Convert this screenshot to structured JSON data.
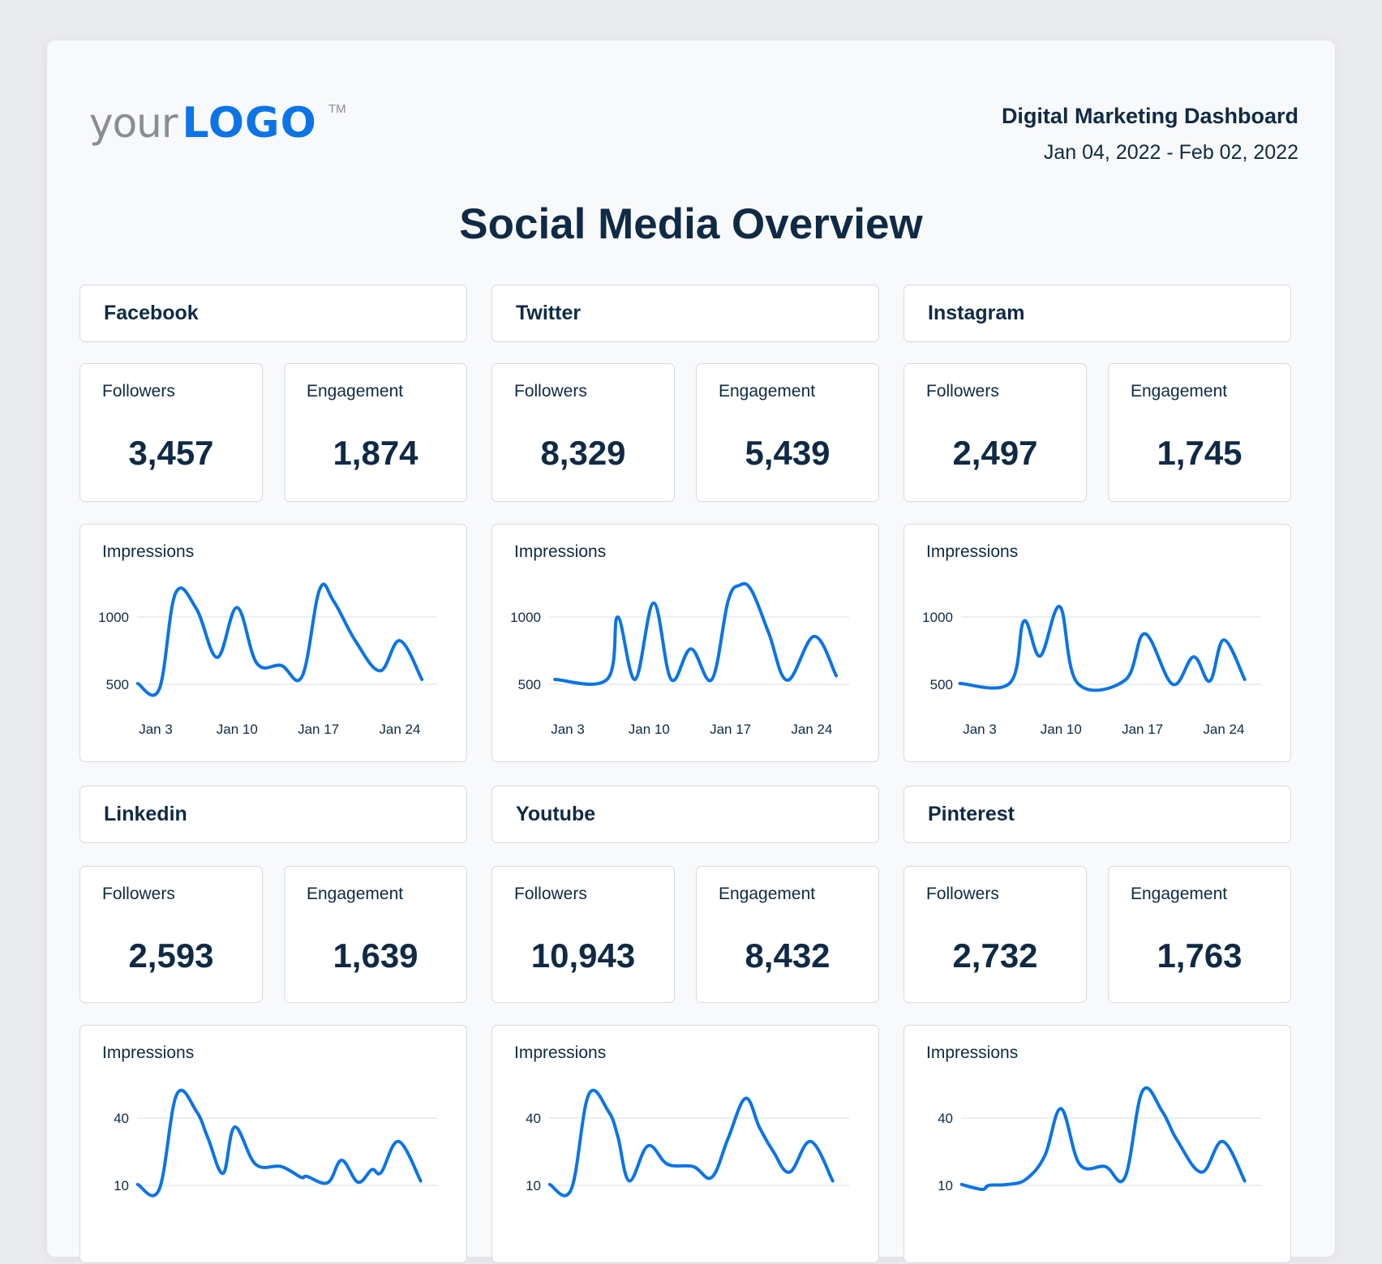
{
  "logo": {
    "your": "your",
    "brand": "LOGO",
    "tm": "TM"
  },
  "header": {
    "title": "Digital Marketing Dashboard",
    "date_range": "Jan 04, 2022 - Feb 02, 2022"
  },
  "page_title": "Social Media Overview",
  "colors": {
    "accent": "#0b74e6",
    "text": "#0f2a45",
    "logo_gray": "#8b8d90",
    "grid": "#e6e8ec"
  },
  "platforms": [
    {
      "name": "Facebook",
      "followers_label": "Followers",
      "followers": "3,457",
      "engagement_label": "Engagement",
      "engagement": "1,874",
      "chart_label": "Impressions"
    },
    {
      "name": "Twitter",
      "followers_label": "Followers",
      "followers": "8,329",
      "engagement_label": "Engagement",
      "engagement": "5,439",
      "chart_label": "Impressions"
    },
    {
      "name": "Instagram",
      "followers_label": "Followers",
      "followers": "2,497",
      "engagement_label": "Engagement",
      "engagement": "1,745",
      "chart_label": "Impressions"
    },
    {
      "name": "Linkedin",
      "followers_label": "Followers",
      "followers": "2,593",
      "engagement_label": "Engagement",
      "engagement": "1,639",
      "chart_label": "Impressions"
    },
    {
      "name": "Youtube",
      "followers_label": "Followers",
      "followers": "10,943",
      "engagement_label": "Engagement",
      "engagement": "8,432",
      "chart_label": "Impressions"
    },
    {
      "name": "Pinterest",
      "followers_label": "Followers",
      "followers": "2,732",
      "engagement_label": "Engagement",
      "engagement": "1,763",
      "chart_label": "Impressions"
    }
  ],
  "chart_data": [
    {
      "type": "line",
      "title": "Impressions",
      "platform": "Facebook",
      "xlabel": "",
      "ylabel": "",
      "grid": true,
      "x_unit": "day of January",
      "x_ticks": [
        3,
        10,
        17,
        24
      ],
      "x_tick_labels": [
        "Jan 3",
        "Jan 10",
        "Jan 17",
        "Jan 24"
      ],
      "y_ticks": [
        500,
        1000
      ],
      "y_tick_labels": [
        "500",
        "1000"
      ],
      "ylim": [
        300,
        1300
      ],
      "xlim": [
        1,
        27
      ],
      "series": [
        {
          "name": "Impressions",
          "x": [
            1.45,
            3.3,
            4.7,
            6.5,
            8.3,
            10.0,
            11.7,
            13.8,
            15.6,
            17.1,
            18.3,
            20.2,
            22.3,
            24.0,
            25.9
          ],
          "y": [
            506,
            464,
            1176,
            1060,
            700,
            1070,
            656,
            640,
            560,
            1204,
            1120,
            820,
            600,
            824,
            536
          ]
        }
      ]
    },
    {
      "type": "line",
      "title": "Impressions",
      "platform": "Twitter",
      "xlabel": "",
      "ylabel": "",
      "grid": true,
      "x_unit": "day of January",
      "x_ticks": [
        3,
        10,
        17,
        24
      ],
      "x_tick_labels": [
        "Jan 3",
        "Jan 10",
        "Jan 17",
        "Jan 24"
      ],
      "y_ticks": [
        500,
        1000
      ],
      "y_tick_labels": [
        "500",
        "1000"
      ],
      "ylim": [
        300,
        1300
      ],
      "xlim": [
        1,
        27
      ],
      "series": [
        {
          "name": "Impressions",
          "x": [
            1.9,
            6.4,
            7.3,
            8.8,
            10.4,
            11.9,
            13.6,
            15.4,
            16.8,
            17.8,
            18.8,
            20.3,
            21.9,
            24.2,
            26.1
          ],
          "y": [
            536,
            538,
            1000,
            536,
            1104,
            536,
            764,
            536,
            1120,
            1236,
            1200,
            880,
            530,
            856,
            564
          ]
        }
      ]
    },
    {
      "type": "line",
      "title": "Impressions",
      "platform": "Instagram",
      "xlabel": "",
      "ylabel": "",
      "grid": true,
      "x_unit": "day of January",
      "x_ticks": [
        3,
        10,
        17,
        24
      ],
      "x_tick_labels": [
        "Jan 3",
        "Jan 10",
        "Jan 17",
        "Jan 24"
      ],
      "y_ticks": [
        500,
        1000
      ],
      "y_tick_labels": [
        "500",
        "1000"
      ],
      "ylim": [
        300,
        1300
      ],
      "xlim": [
        1,
        27
      ],
      "series": [
        {
          "name": "Impressions",
          "x": [
            1.3,
            5.6,
            6.8,
            8.2,
            9.9,
            11.4,
            15.5,
            17.2,
            19.6,
            21.4,
            22.8,
            24.0,
            25.8
          ],
          "y": [
            506,
            510,
            970,
            710,
            1076,
            510,
            530,
            876,
            500,
            704,
            524,
            830,
            536
          ]
        }
      ]
    },
    {
      "type": "line",
      "title": "Impressions",
      "platform": "Linkedin",
      "xlabel": "",
      "ylabel": "",
      "grid": true,
      "x_unit": "day of January",
      "y_ticks": [
        10,
        40
      ],
      "y_tick_labels": [
        "10",
        "40"
      ],
      "ylim": [
        -10,
        60
      ],
      "xlim": [
        1,
        27
      ],
      "series": [
        {
          "name": "Impressions",
          "x": [
            1.45,
            3.3,
            4.8,
            6.5,
            7.5,
            8.8,
            9.8,
            11.6,
            13.8,
            15.5,
            16.0,
            17.8,
            19.0,
            20.4,
            21.6,
            22.4,
            23.9,
            25.8
          ],
          "y": [
            10.4,
            8.2,
            50.4,
            43,
            31,
            15.4,
            36,
            19.4,
            18.4,
            13.6,
            14,
            11.2,
            21.2,
            11.4,
            17,
            15.8,
            29.6,
            12
          ]
        }
      ]
    },
    {
      "type": "line",
      "title": "Impressions",
      "platform": "Youtube",
      "xlabel": "",
      "ylabel": "",
      "grid": true,
      "x_unit": "day of January",
      "y_ticks": [
        10,
        40
      ],
      "y_tick_labels": [
        "10",
        "40"
      ],
      "ylim": [
        -10,
        60
      ],
      "xlim": [
        1,
        27
      ],
      "series": [
        {
          "name": "Impressions",
          "x": [
            1.45,
            3.3,
            4.8,
            6.5,
            7.3,
            8.3,
            9.9,
            11.6,
            13.8,
            15.4,
            16.8,
            18.3,
            19.5,
            20.7,
            22.1,
            23.9,
            25.8
          ],
          "y": [
            10.4,
            8.2,
            50.4,
            43,
            32,
            12,
            27.6,
            19.4,
            18.4,
            13.6,
            31,
            48.8,
            35.8,
            25,
            15.9,
            29.6,
            12
          ]
        }
      ]
    },
    {
      "type": "line",
      "title": "Impressions",
      "platform": "Pinterest",
      "xlabel": "",
      "ylabel": "",
      "grid": true,
      "x_unit": "day of January",
      "y_ticks": [
        10,
        40
      ],
      "y_tick_labels": [
        "10",
        "40"
      ],
      "ylim": [
        -10,
        60
      ],
      "xlim": [
        1,
        27
      ],
      "series": [
        {
          "name": "Impressions",
          "x": [
            1.45,
            3.2,
            3.8,
            5.4,
            7.0,
            8.6,
            10.0,
            11.6,
            13.8,
            15.5,
            17.0,
            18.7,
            20.0,
            22.1,
            23.9,
            25.8
          ],
          "y": [
            10.4,
            8.2,
            10,
            10.4,
            12.8,
            23.2,
            44.2,
            19.4,
            18.4,
            13.6,
            52,
            43,
            30,
            15.9,
            29.6,
            12
          ]
        }
      ]
    }
  ]
}
